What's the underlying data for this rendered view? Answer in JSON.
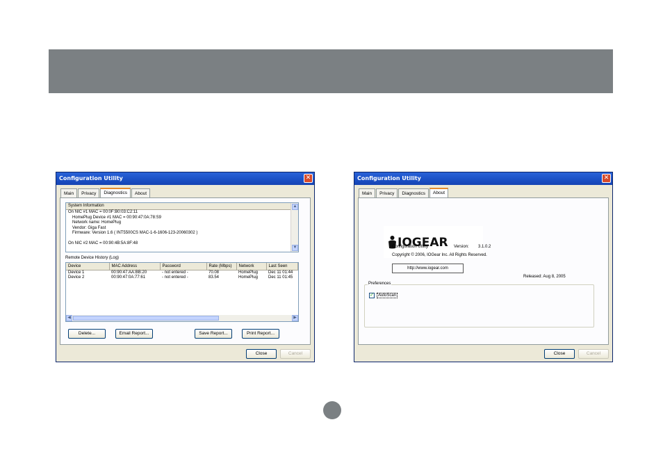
{
  "left_window": {
    "title": "Configuration Utility",
    "tabs": [
      "Main",
      "Privacy",
      "Diagnostics",
      "About"
    ],
    "active_tab": "Diagnostics",
    "system_info": {
      "header": "System Information",
      "lines": [
        "On NIC #1 MAC = 00:0F:B0:03:C2:11",
        "HomePlug Device #1 MAC = 00:90:47:0A:78:S9",
        "Network name: HomePlug",
        "Vendor: Giga Fast",
        "Firmware: Version 1.6   ( INT5500CS MAC-1-6-1606-123-20060302 )",
        "",
        "On NIC #2 MAC = 00:90:4B:5A:8F:48"
      ]
    },
    "log": {
      "title": "Remote Device History (Log)",
      "columns": [
        "Device",
        "MAC Address",
        "Password",
        "Rate (Mbps)",
        "Network",
        "Last Seen"
      ],
      "rows": [
        [
          "Device 1",
          "00:90:47:AA:BB:20",
          "- not entered -",
          "70.08",
          "HomePlug",
          "Dec 11 01:44"
        ],
        [
          "Device 2",
          "00:90:47:0A:77:61",
          "- not entered -",
          "83.54",
          "HomePlug",
          "Dec 11 01:45"
        ]
      ]
    },
    "buttons": {
      "delete": "Delete...",
      "email": "Email Report...",
      "save": "Save Report...",
      "print": "Print Report...",
      "close": "Close",
      "cancel": "Cancel"
    }
  },
  "right_window": {
    "title": "Configuration Utility",
    "tabs": [
      "Main",
      "Privacy",
      "Diagnostics",
      "About"
    ],
    "active_tab": "About",
    "logo_text": "IOGEAR",
    "product": "Configuration Utility",
    "version_label": "Version:",
    "version": "3.1.0.2",
    "copyright": "Copyright © 2006, IOGear Inc. All Rights Reserved.",
    "url": "http://www.iogear.com",
    "released": "Released: Aug 8, 2005",
    "preferences_label": "Preferences",
    "autoscan_label": "AutoScan",
    "autoscan_checked": true,
    "buttons": {
      "close": "Close",
      "cancel": "Cancel"
    }
  }
}
